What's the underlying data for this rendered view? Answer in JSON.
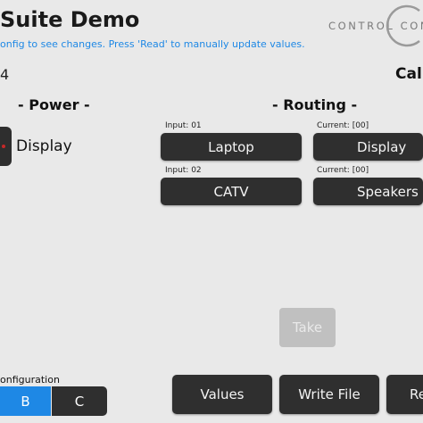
{
  "header": {
    "title": "Suite Demo",
    "subtitle": "onfig to see changes. Press 'Read' to manually update values.",
    "logo_text": "CONTROL CON",
    "left_num": "4",
    "right_label": "Call"
  },
  "power": {
    "title": "- Power -",
    "display_label": "Display"
  },
  "routing": {
    "title": "- Routing -",
    "rows": [
      {
        "input_label": "Input: 01",
        "input_button": "Laptop",
        "current_label": "Current: [00]",
        "output_button": "Display"
      },
      {
        "input_label": "Input: 02",
        "input_button": "CATV",
        "current_label": "Current: [00]",
        "output_button": "Speakers"
      }
    ],
    "take_label": "Take"
  },
  "configuration": {
    "label": "onfiguration",
    "options": [
      "B",
      "C"
    ],
    "selected": "B"
  },
  "actions": {
    "values_label": "Values",
    "write_label": "Write File",
    "read_label": "Re"
  },
  "colors": {
    "accent": "#1e88e5",
    "button": "#2f2f2f",
    "background": "#e9e9e9"
  }
}
